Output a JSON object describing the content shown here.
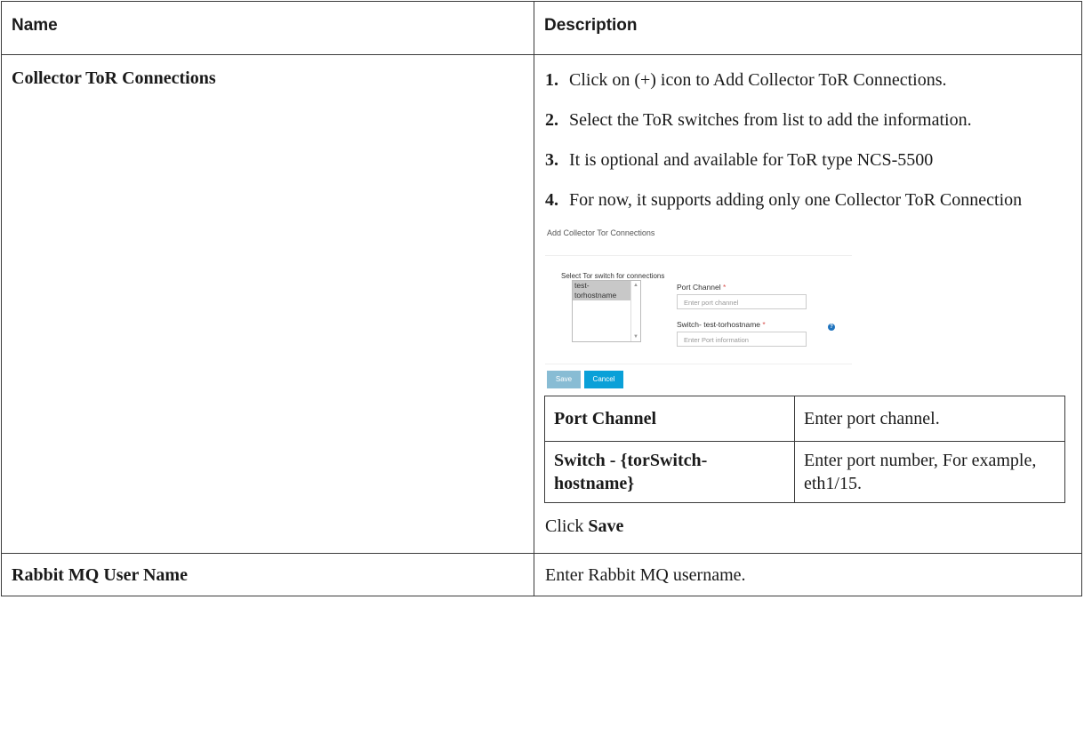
{
  "header": {
    "name": "Name",
    "description": "Description"
  },
  "rows": [
    {
      "name": "Collector ToR Connections",
      "steps": [
        {
          "num": "1.",
          "text": "Click on (+) icon to Add Collector ToR Connections."
        },
        {
          "num": "2.",
          "text": "Select the ToR switches from list to add the information."
        },
        {
          "num": "3.",
          "text": "It is optional and available for ToR type NCS-5500"
        },
        {
          "num": "4.",
          "text": "For now, it supports adding only one Collector ToR Connection"
        }
      ],
      "screenshot": {
        "title": "Add Collector Tor Connections",
        "select_label": "Select Tor switch for connections",
        "list_option": "test-torhostname",
        "port_channel_label": "Port Channel",
        "port_channel_placeholder": "Enter port channel",
        "switch_label": "Switch- test-torhostname",
        "switch_placeholder": "Enter Port information",
        "required_mark": "*",
        "help_icon": "?",
        "save": "Save",
        "cancel": "Cancel"
      },
      "fields": [
        {
          "label": "Port Channel",
          "value": "Enter port channel."
        },
        {
          "label": "Switch - {torSwitch-hostname}",
          "value": "Enter port number, For example, eth1/15."
        }
      ],
      "click_prefix": "Click ",
      "click_bold": "Save"
    },
    {
      "name": "Rabbit MQ User Name",
      "description": "Enter Rabbit MQ username."
    }
  ]
}
